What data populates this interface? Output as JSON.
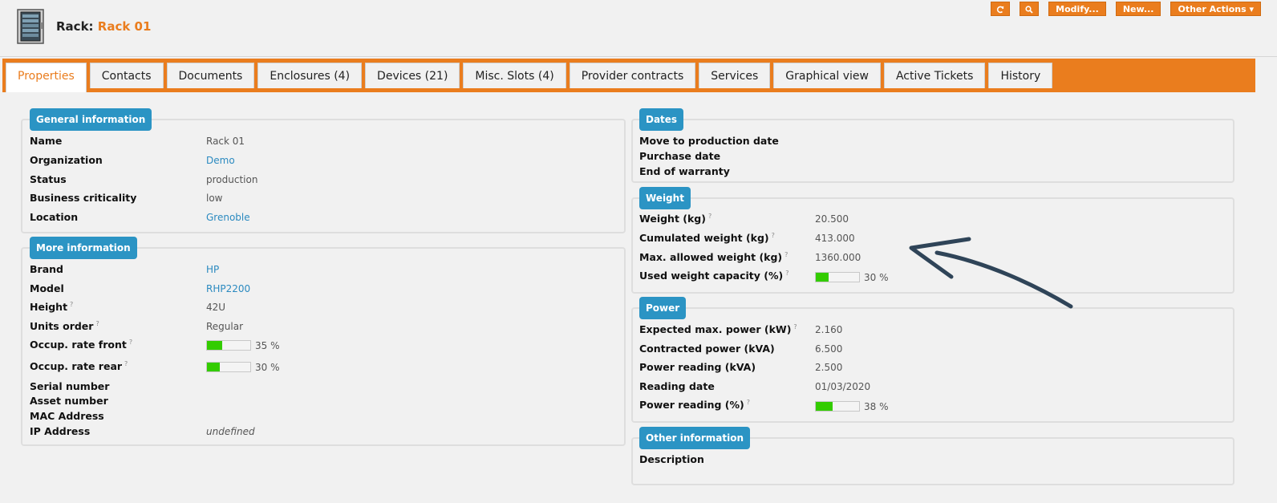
{
  "header": {
    "title_label": "Rack:",
    "title_name": "Rack 01",
    "actions": {
      "refresh_icon": "refresh-icon",
      "search_icon": "search-icon",
      "modify": "Modify...",
      "new": "New...",
      "other": "Other Actions ▾"
    }
  },
  "tabs": [
    {
      "label": "Properties"
    },
    {
      "label": "Contacts"
    },
    {
      "label": "Documents"
    },
    {
      "label": "Enclosures (4)"
    },
    {
      "label": "Devices (21)"
    },
    {
      "label": "Misc. Slots (4)"
    },
    {
      "label": "Provider contracts"
    },
    {
      "label": "Services"
    },
    {
      "label": "Graphical view"
    },
    {
      "label": "Active Tickets"
    },
    {
      "label": "History"
    }
  ],
  "general": {
    "legend": "General information",
    "fields": [
      {
        "label": "Name",
        "value": "Rack 01"
      },
      {
        "label": "Organization",
        "value": "Demo"
      },
      {
        "label": "Status",
        "value": "production"
      },
      {
        "label": "Business criticality",
        "value": "low"
      },
      {
        "label": "Location",
        "value": "Grenoble"
      }
    ]
  },
  "more": {
    "legend": "More information",
    "fields": [
      {
        "label": "Brand",
        "value": "HP"
      },
      {
        "label": "Model",
        "value": "RHP2200"
      },
      {
        "label": "Height",
        "value": "42U"
      },
      {
        "label": "Units order",
        "value": "Regular"
      },
      {
        "label": "Occup. rate front",
        "value": "35 %",
        "percent": 35
      },
      {
        "label": "Occup. rate rear",
        "value": "30 %",
        "percent": 30
      },
      {
        "label": "Serial number",
        "value": ""
      },
      {
        "label": "Asset number",
        "value": ""
      },
      {
        "label": "MAC Address",
        "value": ""
      },
      {
        "label": "IP Address",
        "value": "undefined"
      }
    ]
  },
  "dates": {
    "legend": "Dates",
    "fields": [
      {
        "label": "Move to production date"
      },
      {
        "label": "Purchase date"
      },
      {
        "label": "End of warranty"
      }
    ]
  },
  "weight": {
    "legend": "Weight",
    "fields": [
      {
        "label": "Weight (kg)",
        "value": "20.500"
      },
      {
        "label": "Cumulated weight (kg)",
        "value": "413.000"
      },
      {
        "label": "Max. allowed weight (kg)",
        "value": "1360.000"
      },
      {
        "label": "Used weight capacity (%)",
        "value": "30 %",
        "percent": 30
      }
    ]
  },
  "power": {
    "legend": "Power",
    "fields": [
      {
        "label": "Expected max. power (kW)",
        "value": "2.160"
      },
      {
        "label": "Contracted power (kVA)",
        "value": "6.500"
      },
      {
        "label": "Power reading (kVA)",
        "value": "2.500"
      },
      {
        "label": "Reading date",
        "value": "01/03/2020"
      },
      {
        "label": "Power reading (%)",
        "value": "38 %",
        "percent": 38
      }
    ]
  },
  "other": {
    "legend": "Other information",
    "fields": [
      {
        "label": "Description"
      }
    ]
  },
  "colors": {
    "accent": "#ea7d1e",
    "legend": "#2b94c4",
    "link": "#2b8ac0",
    "progress": "#33cc00"
  }
}
